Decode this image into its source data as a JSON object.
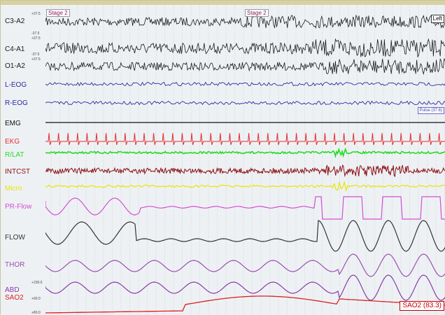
{
  "stages": {
    "first": "Stage 2",
    "second": "Stage 2"
  },
  "corner_tag": "Left",
  "pulse_tag": "Pulse (37.6)",
  "sao2_tag": "SAO2 (83.3)",
  "scale_ticks": {
    "c3_top": "+37.5",
    "c3_bottom": "-37.5",
    "c4_top": "+37.5",
    "c4_bottom": "-37.5",
    "o1_top": "+37.5",
    "abd_top": "+100.0",
    "sao2_mid": "+90.0",
    "sao2_bottom": "+80.0"
  },
  "channels": [
    {
      "label": "C3-A2",
      "color": "#1a1a1a"
    },
    {
      "label": "C4-A1",
      "color": "#1a1a1a"
    },
    {
      "label": "O1-A2",
      "color": "#1a1a1a"
    },
    {
      "label": "L-EOG",
      "color": "#2b2b9c"
    },
    {
      "label": "R-EOG",
      "color": "#2b2b9c"
    },
    {
      "label": "EMG",
      "color": "#111111"
    },
    {
      "label": "EKG",
      "color": "#e23030"
    },
    {
      "label": "R/LAT",
      "color": "#22dd22"
    },
    {
      "label": "INTCST",
      "color": "#8b0f14"
    },
    {
      "label": "Micro",
      "color": "#e6e600"
    },
    {
      "label": "PR-Flow",
      "color": "#d24fd2"
    },
    {
      "label": "FLOW",
      "color": "#333333"
    },
    {
      "label": "THOR",
      "color": "#9a4fb0"
    },
    {
      "label": "ABD",
      "color": "#8a3aa8"
    },
    {
      "label": "SAO2",
      "color": "#d92020"
    }
  ]
}
